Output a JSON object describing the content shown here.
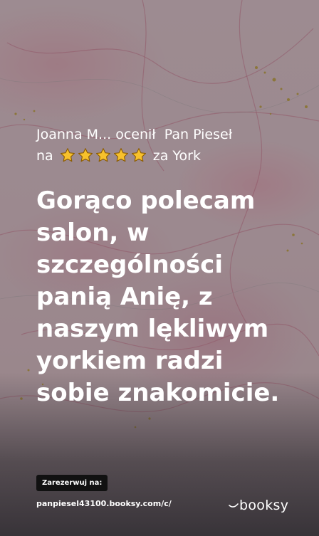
{
  "review": {
    "author": "Joanna M...",
    "verb": "ocenił",
    "business": "Pan Pieseł",
    "prefix": "na",
    "rating": 5,
    "suffix": "za York",
    "text": "Gorąco polecam salon, w szczególności panią Anię, z naszym lękliwym yorkiem radzi sobie znakomicie."
  },
  "booking": {
    "cta_label": "Zarezerwuj na:",
    "url": "panpiesel43100.booksy.com/c/"
  },
  "brand": {
    "name": "booksy"
  },
  "colors": {
    "star": "#f7c12c",
    "badge": "#111111",
    "text": "#ffffff"
  },
  "icons": {
    "star": "star-icon",
    "logo": "booksy-smile-icon"
  }
}
